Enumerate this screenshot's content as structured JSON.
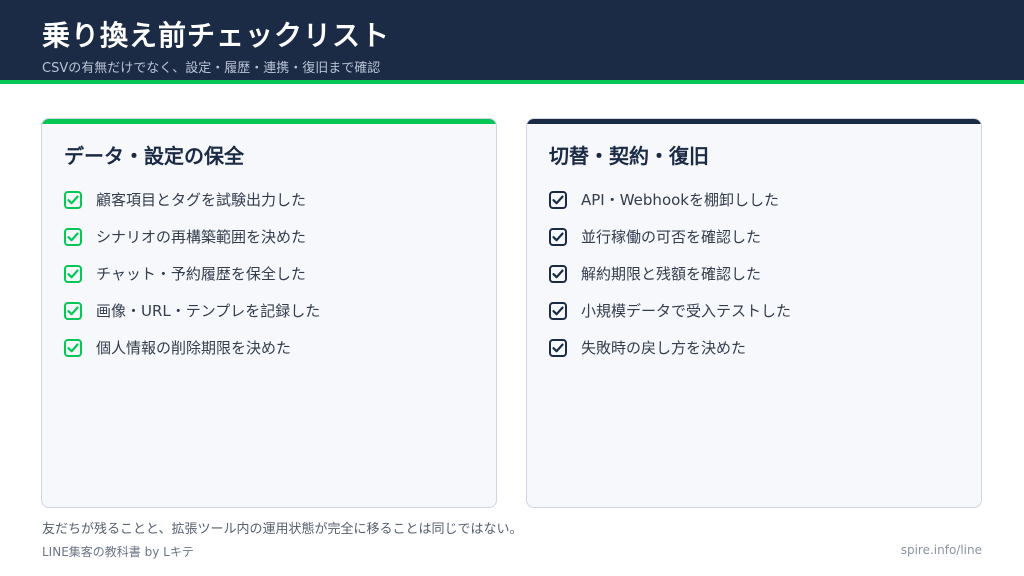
{
  "header": {
    "title": "乗り換え前チェックリスト",
    "subtitle": "CSVの有無だけでなく、設定・履歴・連携・復旧まで確認"
  },
  "colors": {
    "navy": "#1b2a45",
    "green": "#06c755",
    "card_bg": "#f6f8fc"
  },
  "left_card": {
    "heading": "データ・設定の保全",
    "check_icon": "checkbox-checked-icon",
    "items": [
      "顧客項目とタグを試験出力した",
      "シナリオの再構築範囲を決めた",
      "チャット・予約履歴を保全した",
      "画像・URL・テンプレを記録した",
      "個人情報の削除期限を決めた"
    ]
  },
  "right_card": {
    "heading": "切替・契約・復旧",
    "check_icon": "checkbox-checked-icon",
    "items": [
      "API・Webhookを棚卸しした",
      "並行稼働の可否を確認した",
      "解約期限と残額を確認した",
      "小規模データで受入テストした",
      "失敗時の戻し方を決めた"
    ]
  },
  "footnote": "友だちが残ることと、拡張ツール内の運用状態が完全に移ることは同じではない。",
  "footer": {
    "left": "LINE集客の教科書 by Lキテ",
    "right": "spire.info/line"
  }
}
